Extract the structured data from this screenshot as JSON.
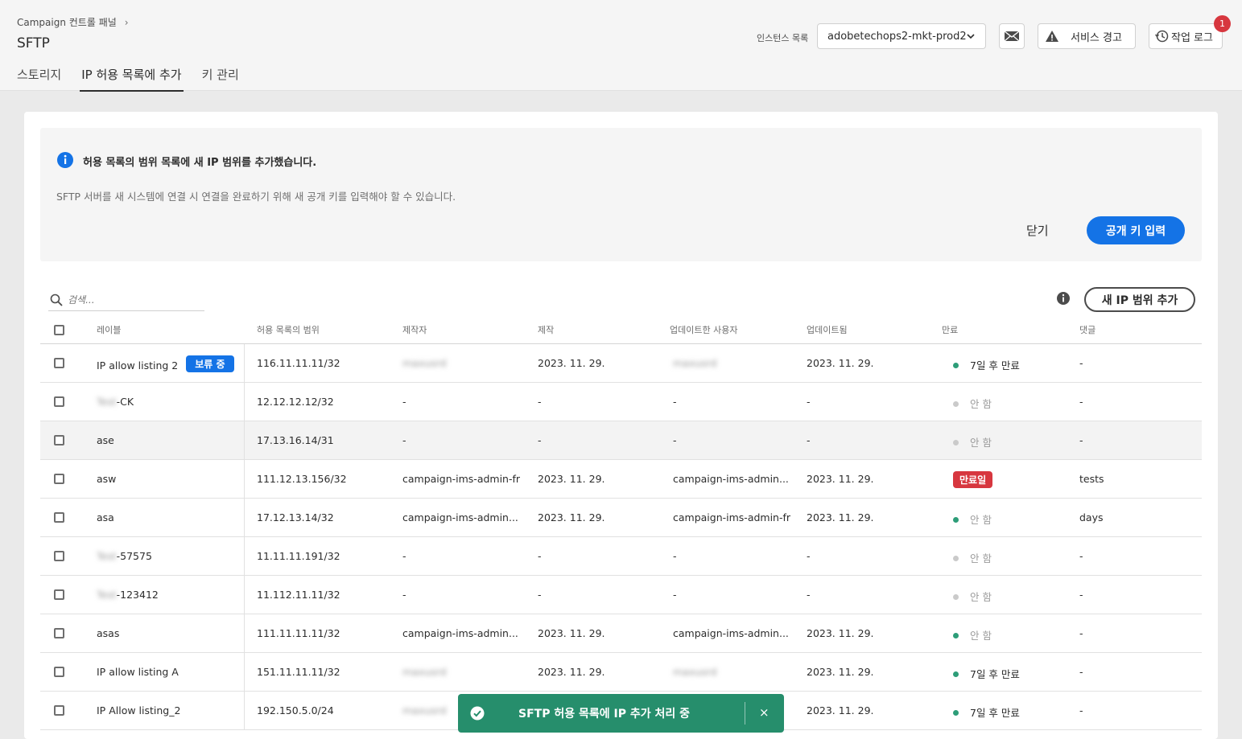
{
  "header": {
    "breadcrumb": "Campaign 컨트롤 패널",
    "breadcrumb_chevron": "›",
    "title": "SFTP",
    "tabs": [
      "스토리지",
      "IP 허용 목록에 추가",
      "키 관리"
    ],
    "active_tab": 1,
    "instance_label": "인스턴스 목록",
    "instance_value": "adobetechops2-mkt-prod2",
    "alert_label": "서비스 경고",
    "log_label": "작업 로그",
    "notification_count": "1"
  },
  "banner": {
    "title": "허용 목록의 범위 목록에 새 IP 범위를 추가했습니다.",
    "text": "SFTP 서버를 새 시스템에 연결 시 연결을 완료하기 위해 새 공개 키를 입력해야 할 수 있습니다.",
    "close_label": "닫기",
    "primary_label": "공개 키 입력"
  },
  "table": {
    "search_placeholder": "검색...",
    "add_button": "새 IP 범위 추가",
    "columns": [
      "레이블",
      "허용 목록의 범위",
      "제작자",
      "제작",
      "업데이트한 사용자",
      "업데이트됨",
      "만료",
      "댓글"
    ],
    "pending_badge": "보류 중",
    "rows": [
      {
        "label_blur": "",
        "label": "IP allow listing 2",
        "pending": true,
        "range": "116.11.11.11/32",
        "creator": "maxusrd",
        "creator_blur": true,
        "created": "2023. 11. 29.",
        "updater": "maxusrd",
        "updater_blur": true,
        "updated": "2023. 11. 29.",
        "expiry": "7일 후 만료",
        "expiry_state": "active",
        "comment": "-"
      },
      {
        "label_blur": "Test",
        "label": "-CK",
        "pending": false,
        "range": "12.12.12.12/32",
        "creator": "-",
        "creator_blur": false,
        "created": "-",
        "updater": "-",
        "updater_blur": false,
        "updated": "-",
        "expiry": "안 함",
        "expiry_state": "none",
        "comment": "-"
      },
      {
        "label_blur": "",
        "label": "ase",
        "pending": false,
        "range": "17.13.16.14/31",
        "creator": "-",
        "creator_blur": false,
        "created": "-",
        "updater": "-",
        "updater_blur": false,
        "updated": "-",
        "expiry": "안 함",
        "expiry_state": "none",
        "comment": "-"
      },
      {
        "label_blur": "",
        "label": "asw",
        "pending": false,
        "range": "111.12.13.156/32",
        "creator": "campaign-ims-admin-fr",
        "creator_blur": false,
        "created": "2023. 11. 29.",
        "updater": "campaign-ims-admin...",
        "updater_blur": false,
        "updated": "2023. 11. 29.",
        "expiry": "만료일",
        "expiry_state": "expired",
        "comment": "tests"
      },
      {
        "label_blur": "",
        "label": "asa",
        "pending": false,
        "range": "17.12.13.14/32",
        "creator": "campaign-ims-admin...",
        "creator_blur": false,
        "created": "2023. 11. 29.",
        "updater": "campaign-ims-admin-fr",
        "updater_blur": false,
        "updated": "2023. 11. 29.",
        "expiry": "안 함",
        "expiry_state": "active-none",
        "comment": "days"
      },
      {
        "label_blur": "Test",
        "label": "-57575",
        "pending": false,
        "range": "11.11.11.191/32",
        "creator": "-",
        "creator_blur": false,
        "created": "-",
        "updater": "-",
        "updater_blur": false,
        "updated": "-",
        "expiry": "안 함",
        "expiry_state": "none",
        "comment": "-"
      },
      {
        "label_blur": "Test",
        "label": "-123412",
        "pending": false,
        "range": "11.112.11.11/32",
        "creator": "-",
        "creator_blur": false,
        "created": "-",
        "updater": "-",
        "updater_blur": false,
        "updated": "-",
        "expiry": "안 함",
        "expiry_state": "none",
        "comment": "-"
      },
      {
        "label_blur": "",
        "label": "asas",
        "pending": false,
        "range": "111.11.11.11/32",
        "creator": "campaign-ims-admin...",
        "creator_blur": false,
        "created": "2023. 11. 29.",
        "updater": "campaign-ims-admin...",
        "updater_blur": false,
        "updated": "2023. 11. 29.",
        "expiry": "안 함",
        "expiry_state": "active-none",
        "comment": "-"
      },
      {
        "label_blur": "",
        "label": "IP allow listing A",
        "pending": false,
        "range": "151.11.11.11/32",
        "creator": "maxusrd",
        "creator_blur": true,
        "created": "2023. 11. 29.",
        "updater": "maxusrd",
        "updater_blur": true,
        "updated": "2023. 11. 29.",
        "expiry": "7일 후 만료",
        "expiry_state": "active",
        "comment": "-"
      },
      {
        "label_blur": "",
        "label": "IP Allow listing_2",
        "pending": false,
        "range": "192.150.5.0/24",
        "creator": "maxusrd",
        "creator_blur": true,
        "created": "",
        "updater": "",
        "updater_blur": false,
        "updated": "2023. 11. 29.",
        "expiry": "7일 후 만료",
        "expiry_state": "active",
        "comment": "-"
      }
    ]
  },
  "toast": {
    "message": "SFTP 허용 목록에 IP 추가 처리 중",
    "close": "×"
  },
  "colors": {
    "accent_blue": "#1473e6",
    "success_green": "#268e6c",
    "danger_red": "#d7373f",
    "active_dot": "#2d9d78",
    "inactive_dot": "#cacaca"
  }
}
